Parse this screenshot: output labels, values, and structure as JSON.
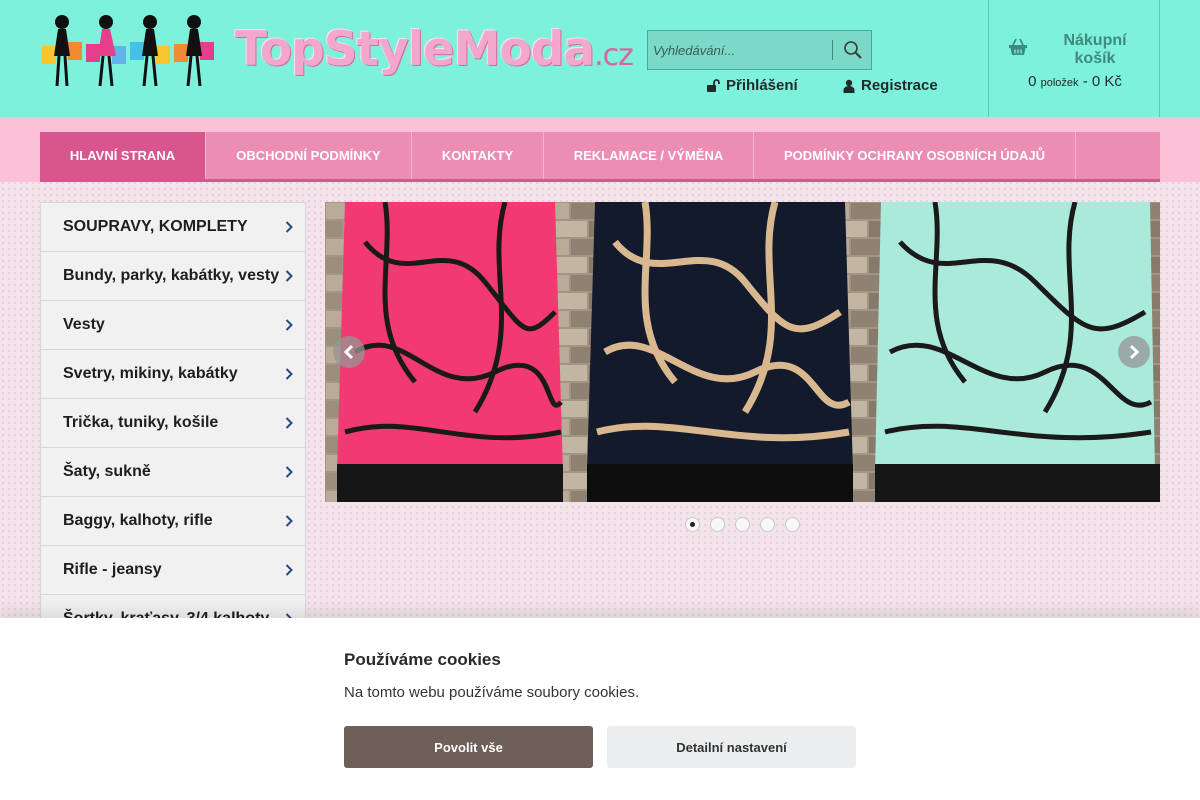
{
  "brand": {
    "logo_text": "TopStyleModa",
    "logo_tld": ".cz",
    "colors": {
      "header_bg": "#7ef1dd",
      "nav_bg": "#ec8db4",
      "nav_active": "#d9558d",
      "accent_pink": "#f4a7cc"
    }
  },
  "search": {
    "placeholder": "Vyhledávání...",
    "icon": "search-icon"
  },
  "account": {
    "login_label": "Přihlášení",
    "register_label": "Registrace"
  },
  "cart": {
    "title": "Nákupní košík",
    "count": "0",
    "count_unit": "položek",
    "separator": "-",
    "total": "0 Kč",
    "icon": "basket-icon"
  },
  "nav": {
    "items": [
      {
        "label": "HLAVNÍ STRANA",
        "active": true
      },
      {
        "label": "OBCHODNÍ PODMÍNKY",
        "active": false
      },
      {
        "label": "KONTAKTY",
        "active": false
      },
      {
        "label": "REKLAMACE / VÝMĚNA",
        "active": false
      },
      {
        "label": "PODMÍNKY OCHRANY OSOBNÍCH ÚDAJŮ",
        "active": false
      }
    ]
  },
  "categories": [
    {
      "label": "SOUPRAVY, KOMPLETY"
    },
    {
      "label": "Bundy, parky, kabátky, vesty"
    },
    {
      "label": "Vesty"
    },
    {
      "label": "Svetry, mikiny, kabátky"
    },
    {
      "label": "Trička, tuniky, košile"
    },
    {
      "label": "Šaty, sukně"
    },
    {
      "label": "Baggy, kalhoty, rifle"
    },
    {
      "label": "Rifle - jeansy"
    },
    {
      "label": "Šortky, kraťasy, 3/4 kalhoty"
    }
  ],
  "slider": {
    "slides_total": 5,
    "active_index": 0,
    "panels": [
      {
        "shirt_color": "#f23a72",
        "pattern_color": "#1a1a1a"
      },
      {
        "shirt_color": "#131a2c",
        "pattern_color": "#d9b88f"
      },
      {
        "shirt_color": "#a9eadb",
        "pattern_color": "#1a1a1a"
      }
    ],
    "prev_icon": "chevron-left-icon",
    "next_icon": "chevron-right-icon"
  },
  "cookies": {
    "title": "Používáme cookies",
    "text": "Na tomto webu používáme soubory cookies.",
    "allow_label": "Povolit vše",
    "detail_label": "Detailní nastavení"
  }
}
